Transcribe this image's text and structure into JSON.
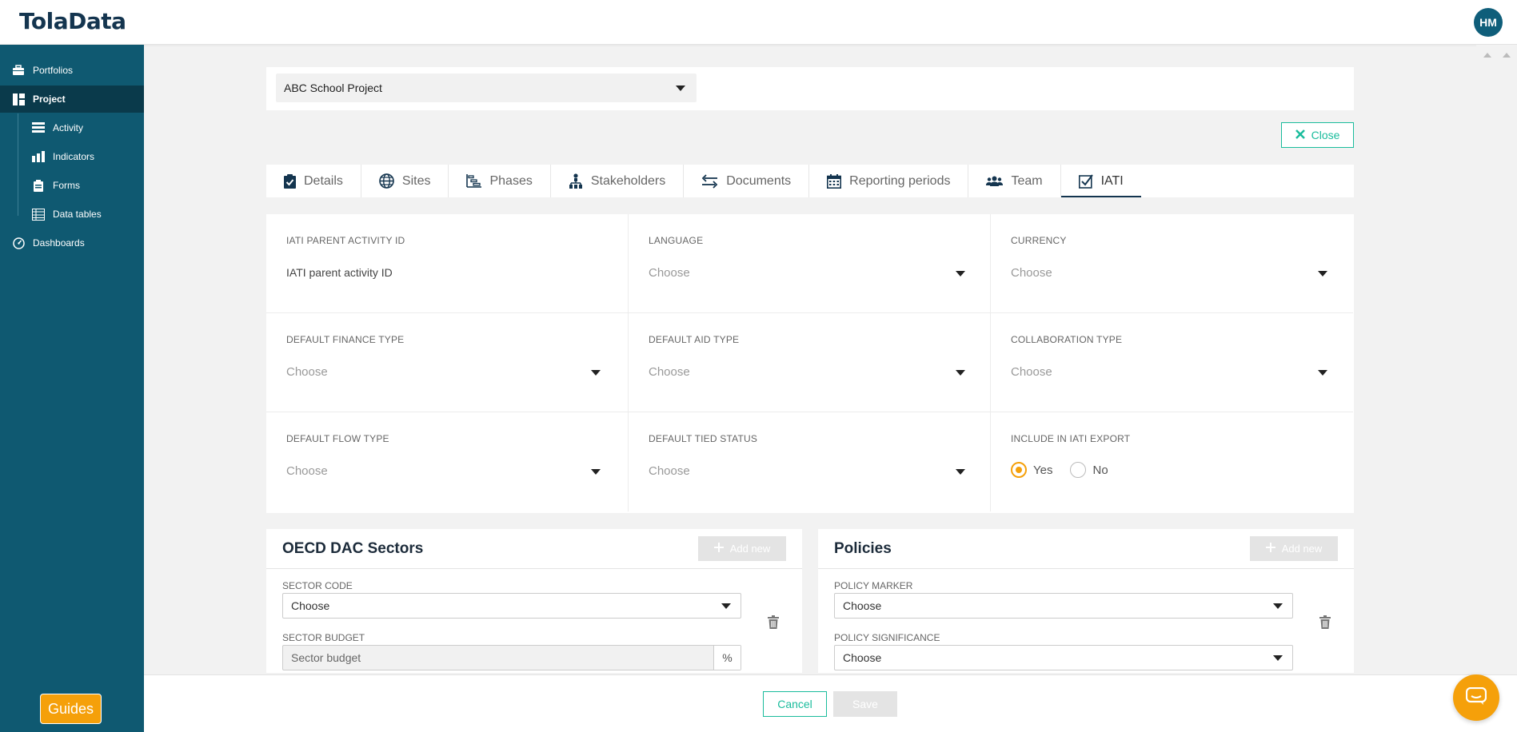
{
  "app": {
    "logo": "TolaData",
    "avatar_initials": "HM"
  },
  "sidebar": {
    "items": [
      {
        "label": "Portfolios",
        "icon": "briefcase-icon"
      },
      {
        "label": "Project",
        "icon": "dashboard-layout-icon",
        "active": true
      },
      {
        "label": "Activity",
        "icon": "list-icon"
      },
      {
        "label": "Indicators",
        "icon": "bar-chart-icon"
      },
      {
        "label": "Forms",
        "icon": "clipboard-icon"
      },
      {
        "label": "Data tables",
        "icon": "table-icon"
      },
      {
        "label": "Dashboards",
        "icon": "gauge-icon"
      }
    ],
    "guides_label": "Guides"
  },
  "project_select": {
    "value": "ABC School Project"
  },
  "close_label": "Close",
  "tabs": [
    {
      "label": "Details",
      "icon": "clipboard-check-icon"
    },
    {
      "label": "Sites",
      "icon": "globe-icon"
    },
    {
      "label": "Phases",
      "icon": "phases-chart-icon"
    },
    {
      "label": "Stakeholders",
      "icon": "hierarchy-icon"
    },
    {
      "label": "Documents",
      "icon": "exchange-arrows-icon"
    },
    {
      "label": "Reporting periods",
      "icon": "calendar-icon"
    },
    {
      "label": "Team",
      "icon": "users-icon"
    },
    {
      "label": "IATI",
      "icon": "checkbox-icon",
      "active": true
    }
  ],
  "iati": {
    "parent_activity_id": {
      "label": "IATI PARENT ACTIVITY ID",
      "value": "IATI parent activity ID"
    },
    "language": {
      "label": "LANGUAGE",
      "value": "Choose"
    },
    "currency": {
      "label": "CURRENCY",
      "value": "Choose"
    },
    "default_finance_type": {
      "label": "DEFAULT FINANCE TYPE",
      "value": "Choose"
    },
    "default_aid_type": {
      "label": "DEFAULT AID TYPE",
      "value": "Choose"
    },
    "collaboration_type": {
      "label": "COLLABORATION TYPE",
      "value": "Choose"
    },
    "default_flow_type": {
      "label": "DEFAULT FLOW TYPE",
      "value": "Choose"
    },
    "default_tied_status": {
      "label": "DEFAULT TIED STATUS",
      "value": "Choose"
    },
    "include_in_export": {
      "label": "INCLUDE IN IATI EXPORT",
      "yes": "Yes",
      "no": "No",
      "selected": "Yes"
    }
  },
  "sectors": {
    "title": "OECD DAC Sectors",
    "add_new": "Add new",
    "sector_code_label": "SECTOR CODE",
    "sector_code_value": "Choose",
    "sector_budget_label": "SECTOR BUDGET",
    "sector_budget_placeholder": "Sector budget",
    "percent_symbol": "%"
  },
  "policies": {
    "title": "Policies",
    "add_new": "Add new",
    "policy_marker_label": "POLICY MARKER",
    "policy_marker_value": "Choose",
    "policy_significance_label": "POLICY SIGNIFICANCE",
    "policy_significance_value": "Choose"
  },
  "footer": {
    "cancel": "Cancel",
    "save": "Save"
  },
  "colors": {
    "sidebar": "#0f5971",
    "accent": "#1abc9c",
    "orange": "#f5a00a",
    "brand": "#14354f"
  }
}
